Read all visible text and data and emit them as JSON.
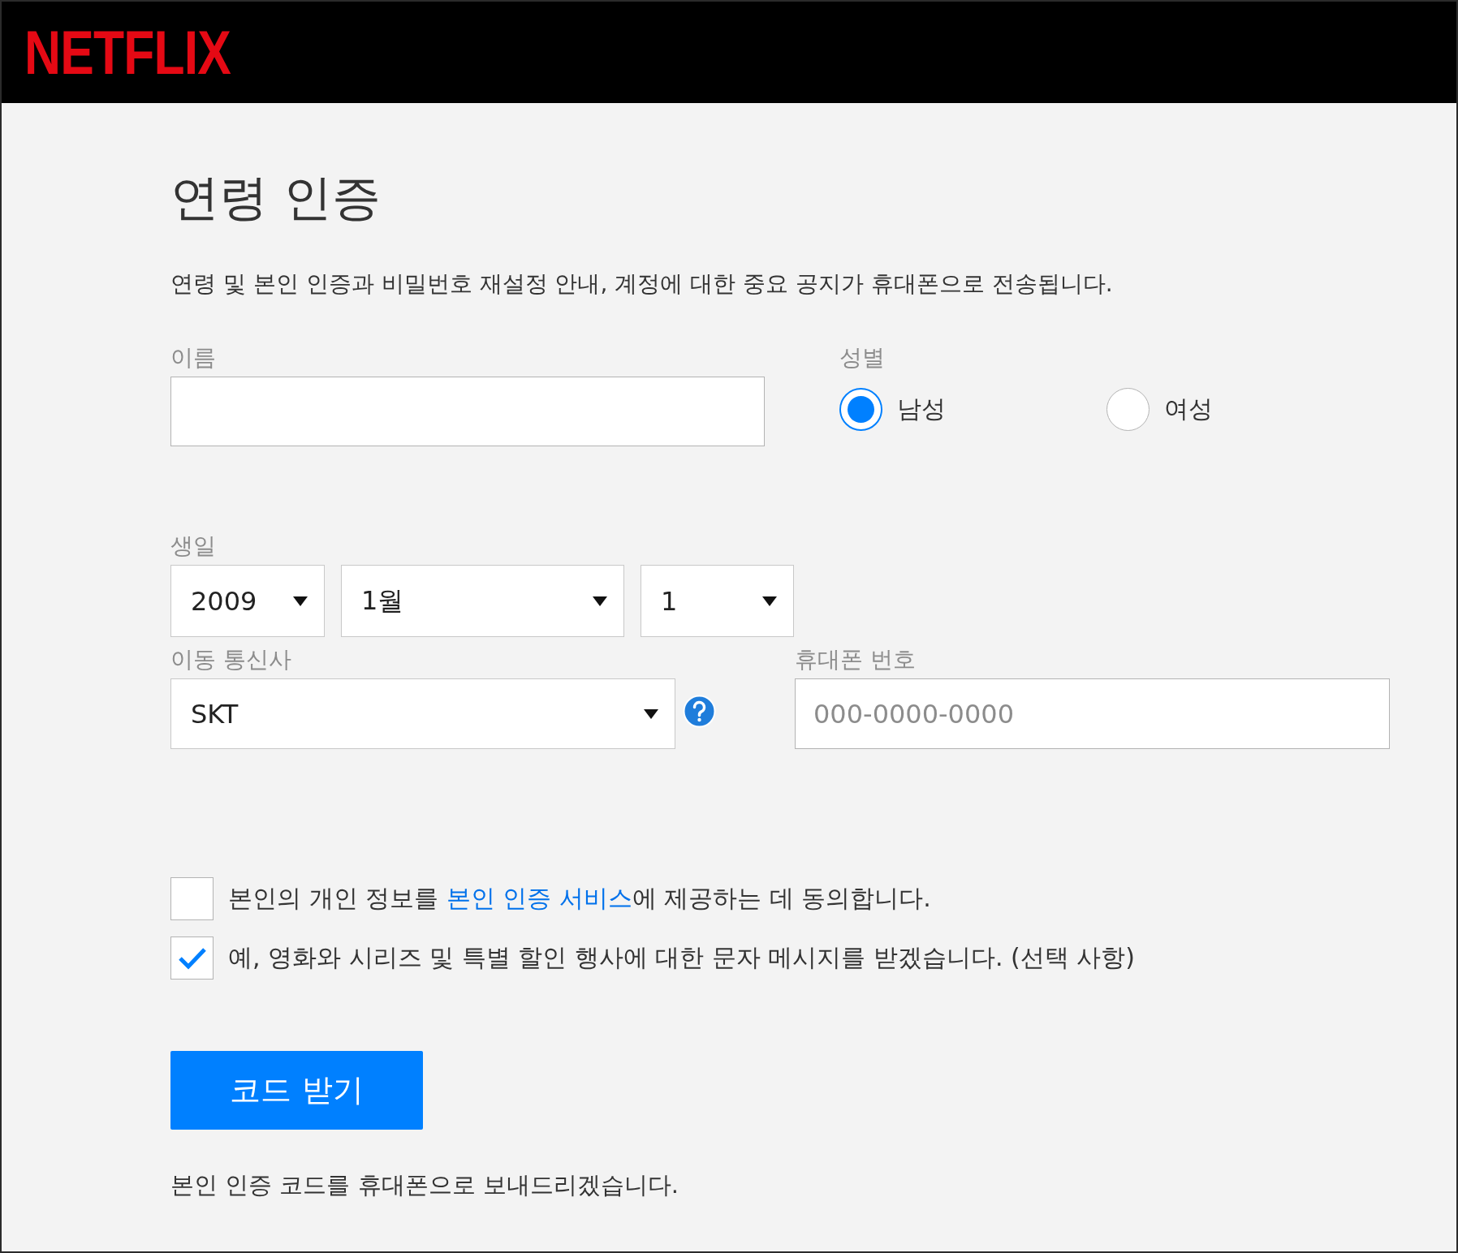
{
  "header": {
    "logo": "NETFLIX"
  },
  "title": "연령 인증",
  "description": "연령 및 본인 인증과 비밀번호 재설정 안내, 계정에 대한 중요 공지가 휴대폰으로 전송됩니다.",
  "name_field": {
    "label": "이름"
  },
  "gender": {
    "label": "성별",
    "options": [
      {
        "label": "남성",
        "selected": true
      },
      {
        "label": "여성",
        "selected": false
      }
    ]
  },
  "birthday": {
    "label": "생일",
    "selects": [
      {
        "value": "2009"
      },
      {
        "value": "1월"
      },
      {
        "value": "1"
      }
    ]
  },
  "carrier": {
    "label": "이동 통신사",
    "value": "SKT"
  },
  "phone": {
    "label": "휴대폰 번호",
    "placeholder": "000-0000-0000"
  },
  "consents": [
    {
      "before": "본인의 개인 정보를 ",
      "link": "본인 인증 서비스",
      "after": "에 제공하는 데 동의합니다.",
      "checked": false
    },
    {
      "before": "예, 영화와 시리즈 및 특별 할인 행사에 대한 문자 메시지를 받겠습니다. (선택 사항)",
      "checked": true
    }
  ],
  "button": "코드 받기",
  "note": "본인 인증 코드를 휴대폰으로 보내드리겠습니다."
}
